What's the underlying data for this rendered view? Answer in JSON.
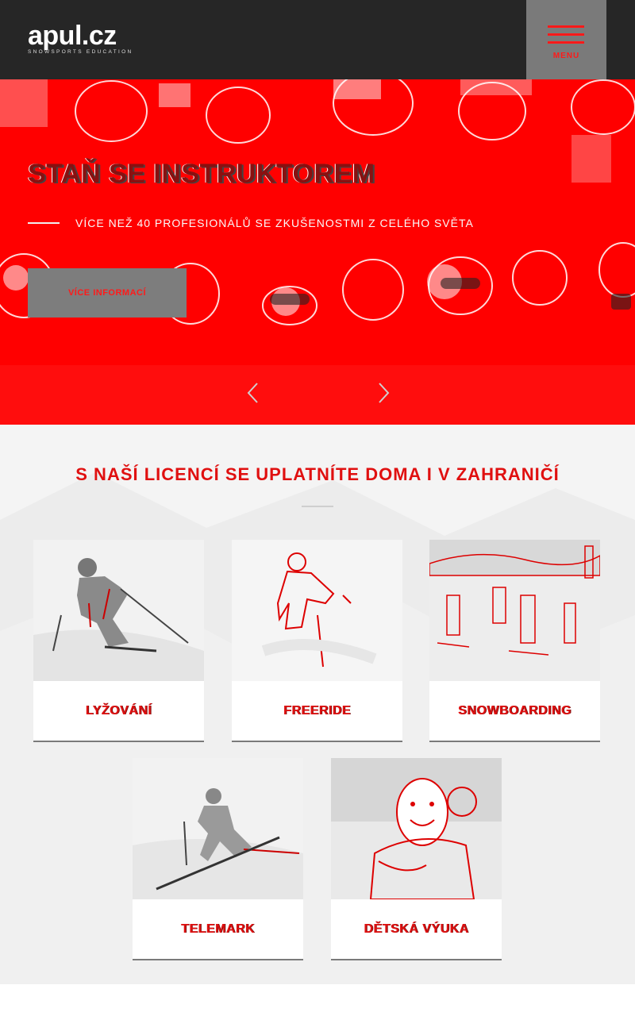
{
  "header": {
    "logo_main": "apul.cz",
    "logo_sub": "SNOWSPORTS EDUCATION",
    "menu_label": "MENU"
  },
  "hero": {
    "title": "STAŇ SE INSTRUKTOREM",
    "subtitle": "VÍCE NEŽ 40 PROFESIONÁLŮ SE ZKUŠENOSTMI Z CELÉHO SVĚTA",
    "button_label": "VÍCE INFORMACÍ",
    "prev_icon": "chevron-left-icon",
    "next_icon": "chevron-right-icon"
  },
  "section": {
    "title": "S NAŠÍ LICENCÍ SE UPLATNÍTE DOMA I V ZAHRANIČÍ",
    "cards": [
      {
        "label": "LYŽOVÁNÍ"
      },
      {
        "label": "FREERIDE"
      },
      {
        "label": "SNOWBOARDING"
      },
      {
        "label": "TELEMARK"
      },
      {
        "label": "DĚTSKÁ VÝUKA"
      }
    ]
  },
  "colors": {
    "accent": "#ff0000",
    "header_bg": "#262626",
    "menu_bg": "#7a7a7a",
    "button_bg": "#7d7d7d"
  }
}
